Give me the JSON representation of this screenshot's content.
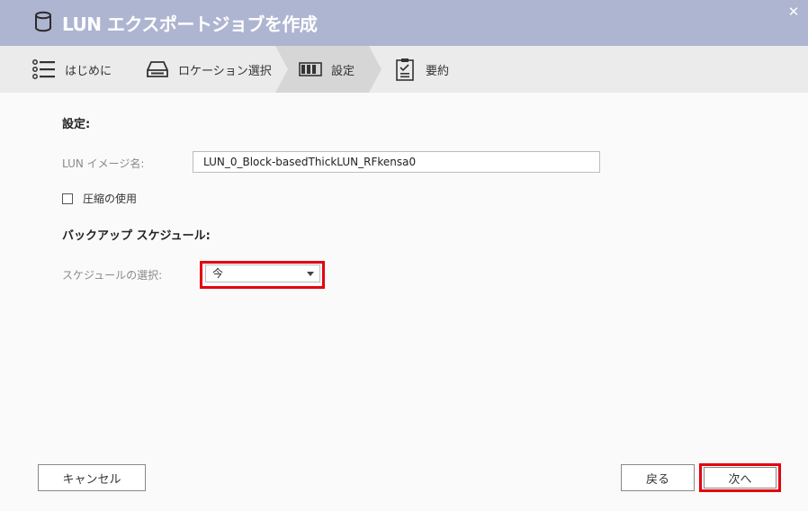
{
  "window": {
    "title": "LUN エクスポートジョブを作成",
    "close_symbol": "✕"
  },
  "steps": [
    {
      "label": "はじめに",
      "icon": "list-icon"
    },
    {
      "label": "ロケーション選択",
      "icon": "drive-icon"
    },
    {
      "label": "設定",
      "icon": "settings-columns-icon",
      "active": true
    },
    {
      "label": "要約",
      "icon": "clipboard-icon"
    }
  ],
  "settings": {
    "section_title": "設定:",
    "lun_name_label": "LUN イメージ名:",
    "lun_name_value": "LUN_0_Block-basedThickLUN_RFkensa0",
    "compression_label": "圧縮の使用",
    "compression_checked": false
  },
  "schedule": {
    "section_title": "バックアップ スケジュール:",
    "select_label": "スケジュールの選択:",
    "selected_value": "今"
  },
  "footer": {
    "cancel_label": "キャンセル",
    "back_label": "戻る",
    "next_label": "次へ"
  },
  "colors": {
    "titlebar": "#aeb5d1",
    "highlight": "#e4000f",
    "steps_bg": "#ebebeb",
    "active_step_bg": "#d6d6d6"
  }
}
